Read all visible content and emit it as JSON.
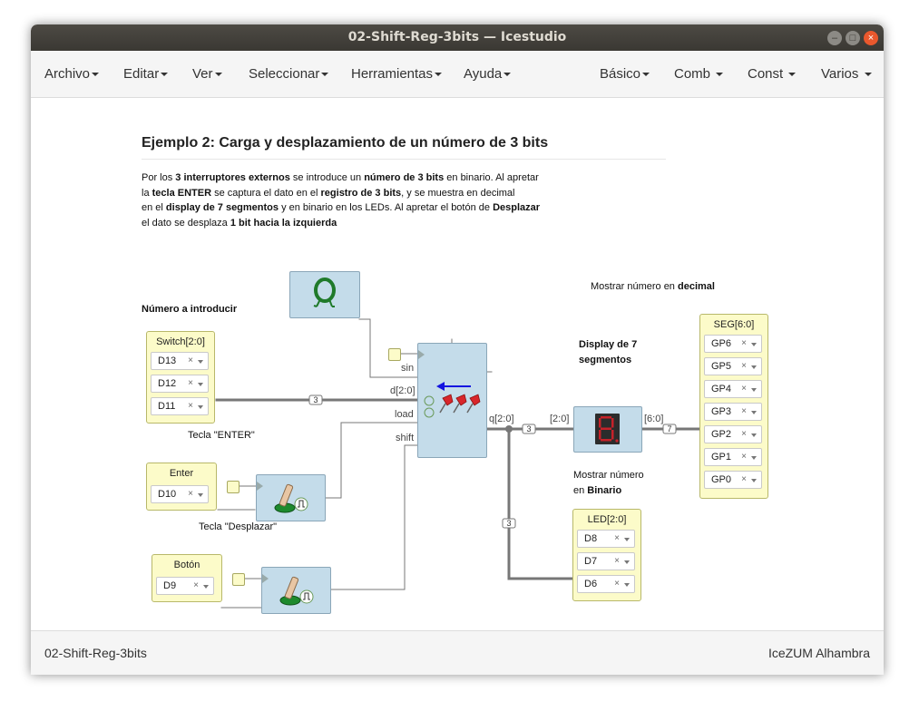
{
  "window": {
    "title": "02-Shift-Reg-3bits — Icestudio"
  },
  "menu": {
    "left": [
      "Archivo",
      "Editar",
      "Ver",
      "Seleccionar",
      "Herramientas",
      "Ayuda"
    ],
    "right": [
      "Básico",
      "Comb",
      "Const",
      "Varios"
    ]
  },
  "doc": {
    "heading": "Ejemplo 2: Carga y desplazamiento de un número de 3 bits",
    "para": [
      [
        "Por los ",
        "3 interruptores externos",
        " se introduce un ",
        "número de 3 bits",
        " en binario. Al apretar"
      ],
      [
        "la ",
        "tecla ENTER",
        " se captura el dato en el ",
        "registro de 3 bits",
        ", y se muestra en decimal"
      ],
      [
        "en el ",
        "display de 7 segmentos",
        " y en binario en los LEDs. Al apretar el botón de ",
        "Desplazar"
      ],
      [
        "el dato se desplaza ",
        "1 bit hacia la izquierda"
      ]
    ],
    "note_input": "Número a introducir",
    "note_decimal_a": "Mostrar número en ",
    "note_decimal_b": "decimal",
    "note_display_1": "Display de 7",
    "note_display_2": "segmentos",
    "note_enter": "Tecla \"ENTER\"",
    "note_shift": "Tecla \"Desplazar\"",
    "note_bin_1": "Mostrar número",
    "note_bin_2a": "en ",
    "note_bin_2b": "Binario"
  },
  "switch_block": {
    "label": "Switch[2:0]",
    "pins": [
      "D13",
      "D12",
      "D11"
    ]
  },
  "enter_block": {
    "label": "Enter",
    "pins": [
      "D10"
    ]
  },
  "boton_block": {
    "label": "Botón",
    "pins": [
      "D9"
    ]
  },
  "seg_block": {
    "label": "SEG[6:0]",
    "pins": [
      "GP6",
      "GP5",
      "GP4",
      "GP3",
      "GP2",
      "GP1",
      "GP0"
    ]
  },
  "led_block": {
    "label": "LED[2:0]",
    "pins": [
      "D8",
      "D7",
      "D6"
    ]
  },
  "register": {
    "ports": {
      "sin": "sin",
      "d": "d[2:0]",
      "load": "load",
      "shift": "shift",
      "q": "q[2:0]"
    }
  },
  "decoder": {
    "in": "[2:0]",
    "out": "[6:0]"
  },
  "bus_badges": {
    "b3": "3",
    "b7": "7"
  },
  "clear_glyph": "×",
  "colors": {
    "io_fill": "#fcfbc9",
    "block_fill": "#c4dcea",
    "wire": "#777777",
    "arrow": "#1414e0",
    "pin_red": "#d8262b",
    "seg_red": "#c6222a"
  },
  "status": {
    "left": "02-Shift-Reg-3bits",
    "right": "IceZUM Alhambra"
  }
}
